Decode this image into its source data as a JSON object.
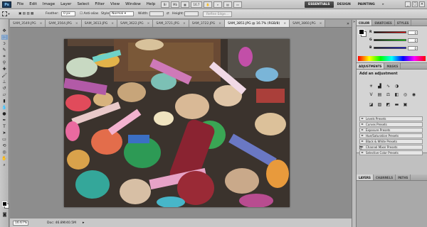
{
  "app": {
    "logo": "Ps"
  },
  "menus": [
    "File",
    "Edit",
    "Image",
    "Layer",
    "Select",
    "Filter",
    "View",
    "Window",
    "Help"
  ],
  "appbar": {
    "zoom": "16.7",
    "icons": [
      "bridge-icon",
      "mini-bridge-icon",
      "zoom-level"
    ]
  },
  "workspaces": {
    "items": [
      "ESSENTIALS",
      "DESIGN",
      "PAINTING",
      "»"
    ],
    "active": "ESSENTIALS"
  },
  "window_controls": [
    "_",
    "□",
    "×"
  ],
  "options_bar": {
    "feather_label": "Feather:",
    "feather_value": "0 px",
    "antialias_label": "Anti-alias",
    "style_label": "Style:",
    "style_value": "Normal",
    "width_label": "Width:",
    "height_label": "Height:",
    "refine_label": "Refine Edge..."
  },
  "tabs": [
    {
      "label": "SAM_3549.JPG",
      "active": false
    },
    {
      "label": "SAM_3564.JPG",
      "active": false
    },
    {
      "label": "SAM_3613.JPG",
      "active": false
    },
    {
      "label": "SAM_3622.JPG",
      "active": false
    },
    {
      "label": "SAM_3721.JPG",
      "active": false
    },
    {
      "label": "SAM_3722.JPG",
      "active": false
    },
    {
      "label": "SAM_3851.JPG @ 16.7% (RGB/8)",
      "active": true
    },
    {
      "label": "SAM_3860.JPG",
      "active": false
    }
  ],
  "tab_close": "×",
  "tab_more": "»",
  "status": {
    "zoom": "16.67%",
    "doc": "Doc: 46.8M/40.5M"
  },
  "color_panel": {
    "tabs": [
      "COLOR",
      "SWATCHES",
      "STYLES"
    ],
    "active_tab": "COLOR",
    "r_label": "R",
    "g_label": "G",
    "b_label": "B",
    "r": "0",
    "g": "0",
    "b": "0"
  },
  "adjustments": {
    "tabs": [
      "ADJUSTMENTS",
      "MASKS"
    ],
    "active_tab": "ADJUSTMENTS",
    "title": "Add an adjustment",
    "presets": [
      "Levels Presets",
      "Curves Presets",
      "Exposure Presets",
      "Hue/Saturation Presets",
      "Black & White Presets",
      "Channel Mixer Presets",
      "Selective Color Presets"
    ]
  },
  "layers": {
    "tabs": [
      "LAYERS",
      "CHANNELS",
      "PATHS"
    ],
    "active_tab": "LAYERS"
  },
  "colors": {
    "foreground": "#000000",
    "background": "#ffffff",
    "workspace_active": "#3d3d3d",
    "tool_selected": "#7d9fc6"
  }
}
